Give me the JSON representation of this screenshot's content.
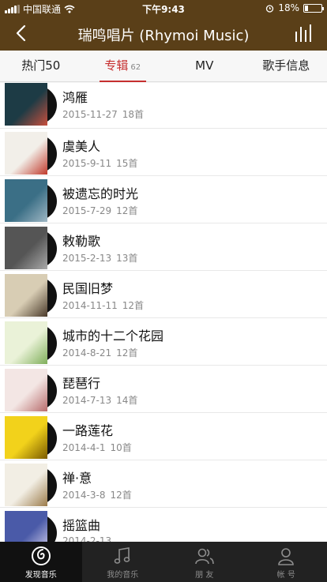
{
  "status": {
    "carrier": "中国联通",
    "time": "下午9:43",
    "battery": "18%",
    "battery_level": 0.18
  },
  "nav": {
    "title": "瑞鸣唱片 (Rhymoi Music)"
  },
  "tabs": [
    {
      "label": "热门50",
      "count": ""
    },
    {
      "label": "专辑",
      "count": "62"
    },
    {
      "label": "MV",
      "count": ""
    },
    {
      "label": "歌手信息",
      "count": ""
    }
  ],
  "albums": [
    {
      "name": "鸿雁",
      "date": "2015-11-27",
      "tracks": "18首",
      "colors": [
        "#1d3b45",
        "#c94f3d"
      ]
    },
    {
      "name": "虞美人",
      "date": "2015-9-11",
      "tracks": "15首",
      "colors": [
        "#f2efe9",
        "#c0392b"
      ]
    },
    {
      "name": "被遗忘的时光",
      "date": "2015-7-29",
      "tracks": "12首",
      "colors": [
        "#3b6f86",
        "#9fb7c4"
      ]
    },
    {
      "name": "敕勒歌",
      "date": "2015-2-13",
      "tracks": "13首",
      "colors": [
        "#555555",
        "#aaaaaa"
      ]
    },
    {
      "name": "民国旧梦",
      "date": "2014-11-11",
      "tracks": "12首",
      "colors": [
        "#d8cdb4",
        "#4a3a2a"
      ]
    },
    {
      "name": "城市的十二个花园",
      "date": "2014-8-21",
      "tracks": "12首",
      "colors": [
        "#eaf2d8",
        "#7fae5a"
      ]
    },
    {
      "name": "琵琶行",
      "date": "2014-7-13",
      "tracks": "14首",
      "colors": [
        "#f3e6e4",
        "#b76b6b"
      ]
    },
    {
      "name": "一路莲花",
      "date": "2014-4-1",
      "tracks": "10首",
      "colors": [
        "#f2d21b",
        "#7a5a00"
      ]
    },
    {
      "name": "禅·意",
      "date": "2014-3-8",
      "tracks": "12首",
      "colors": [
        "#f2eee4",
        "#9b7b4a"
      ]
    },
    {
      "name": "摇篮曲",
      "date": "2014-2-13",
      "tracks": "",
      "colors": [
        "#4a5aa8",
        "#d8d4ee"
      ]
    }
  ],
  "tabbar": [
    {
      "label": "发现音乐",
      "icon": "netease-logo-icon"
    },
    {
      "label": "我的音乐",
      "icon": "music-note-icon"
    },
    {
      "label": "朋 友",
      "icon": "friends-icon"
    },
    {
      "label": "帐 号",
      "icon": "account-icon"
    }
  ]
}
